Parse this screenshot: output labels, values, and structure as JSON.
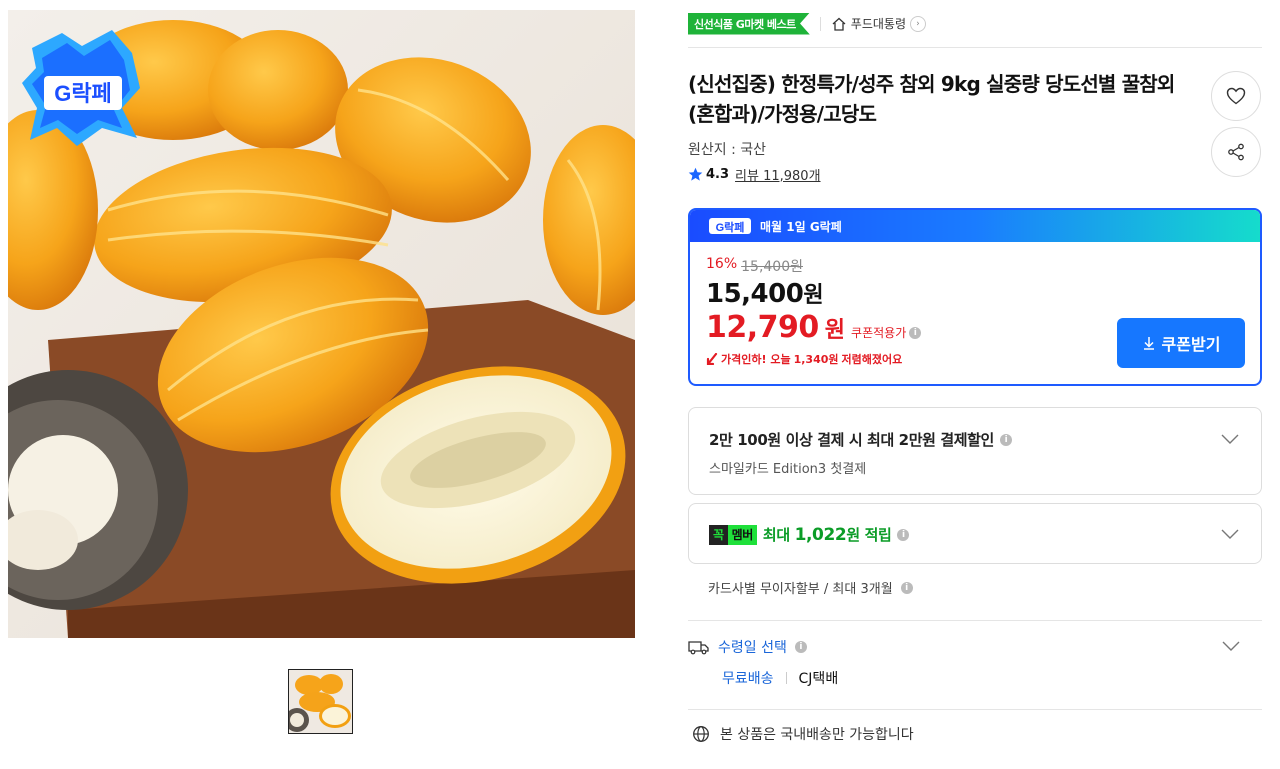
{
  "image": {
    "promo_badge": "G락페"
  },
  "breadcrumb": {
    "best_badge": "신선식품 G마켓 베스트",
    "category": "푸드대통령",
    "arrow": "›"
  },
  "product": {
    "title": "(신선집중) 한정특가/성주 참외 9kg 실중량 당도선별 꿀참외(혼합과)/가정용/고당도",
    "origin": "원산지 : 국산",
    "rating": "4.3",
    "review": "리뷰 11,980개"
  },
  "price_box": {
    "promo_logo": "G락페",
    "promo_text": "매월 1일 G락페",
    "discount_rate": "16%",
    "original_price": "15,400원",
    "sale_price": "15,400",
    "won": "원",
    "coupon_price": "12,790",
    "coupon_won": "원",
    "coupon_label": "쿠폰적용가",
    "price_drop_prefix": "가격인하! 오늘",
    "price_drop_amount": "1,340원",
    "price_drop_suffix": "저렴해졌어요",
    "coupon_button": "쿠폰받기"
  },
  "card_discount": {
    "main": "2만 100원 이상 결제 시 최대 2만원 결제할인",
    "sub": "스마일카드 Edition3 첫결제"
  },
  "card_member": {
    "tag_a": "꼭",
    "tag_b": "멤버",
    "prefix": "최대",
    "amount": "1,022",
    "suffix": "원 적립"
  },
  "installment": "카드사별 무이자할부 / 최대 3개월",
  "delivery": {
    "label": "수령일 선택",
    "free": "무료배송",
    "carrier": "CJ택배"
  },
  "domestic": "본 상품은 국내배송만 가능합니다",
  "colors": {
    "accent_blue": "#1677ff",
    "price_red": "#e31b23",
    "best_green": "#1fb339"
  }
}
